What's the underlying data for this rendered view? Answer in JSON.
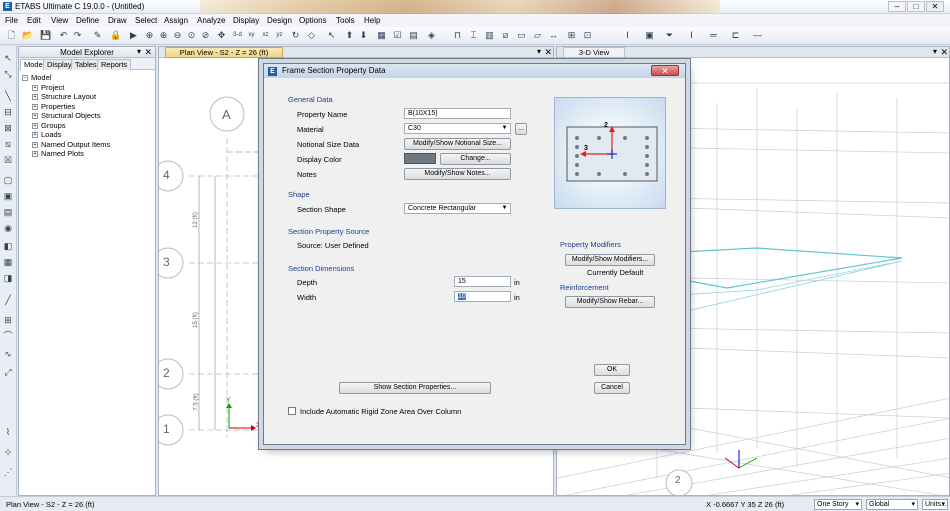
{
  "app": {
    "title": "ETABS Ultimate C 19.0.0 - (Untitled)"
  },
  "menu": [
    "File",
    "Edit",
    "View",
    "Define",
    "Draw",
    "Select",
    "Assign",
    "Analyze",
    "Display",
    "Design",
    "Options",
    "Tools",
    "Help"
  ],
  "explorer": {
    "title": "Model Explorer",
    "tabs": [
      "Model",
      "Display",
      "Tables",
      "Reports"
    ],
    "root": "Model",
    "items": [
      "Project",
      "Structure Layout",
      "Properties",
      "Structural Objects",
      "Groups",
      "Loads",
      "Named Output Items",
      "Named Plots"
    ]
  },
  "plan_view": {
    "tab": "Plan View - S2 - Z = 26 (ft)",
    "grid_letters": [
      "A"
    ],
    "grid_numbers": [
      "4",
      "3",
      "2",
      "1"
    ],
    "dims": [
      "12 (ft)",
      "15 (ft)",
      "7.5 (ft)"
    ],
    "axis_x": "X",
    "axis_y": "Y"
  },
  "view3d": {
    "tab": "3-D View",
    "grid_bubble": "2"
  },
  "dialog": {
    "title": "Frame Section Property Data",
    "general_data": "General Data",
    "property_name_label": "Property Name",
    "property_name": "B(10X15)",
    "material_label": "Material",
    "material": "C30",
    "material_more": "...",
    "notional_label": "Notional Size Data",
    "notional_btn": "Modify/Show Notional Size...",
    "color_label": "Display Color",
    "color_btn": "Change...",
    "notes_label": "Notes",
    "notes_btn": "Modify/Show Notes...",
    "shape_section": "Shape",
    "section_shape_label": "Section Shape",
    "section_shape": "Concrete Rectangular",
    "source_section": "Section Property Source",
    "source_text": "Source:  User Defined",
    "dims_section": "Section Dimensions",
    "depth_label": "Depth",
    "depth": "15",
    "depth_unit": "in",
    "width_label": "Width",
    "width": "10",
    "width_unit": "in",
    "modifiers_section": "Property Modifiers",
    "modifiers_btn": "Modify/Show Modifiers...",
    "modifiers_status": "Currently Default",
    "reinf_section": "Reinforcement",
    "reinf_btn": "Modify/Show Rebar...",
    "show_props_btn": "Show Section Properties...",
    "ok": "OK",
    "cancel": "Cancel",
    "rigid_zone_label": "Include Automatic Rigid Zone Area Over Column",
    "preview_axis_2": "2",
    "preview_axis_3": "3",
    "color_swatch": "#6f7880"
  },
  "status": {
    "left": "Plan View - S2 - Z = 26 (ft)",
    "coords": "X -0.6667  Y 35  Z 26 (ft)",
    "story": "One Story",
    "system": "Global",
    "units": "Units..."
  }
}
